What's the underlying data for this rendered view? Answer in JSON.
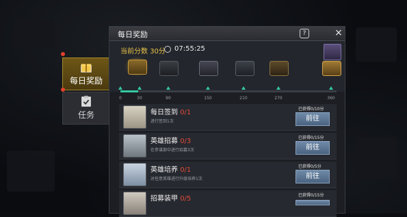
{
  "side_tabs": [
    {
      "label": "每日奖励",
      "icon": "gift-icon",
      "active": true
    },
    {
      "label": "任务",
      "icon": "clipboard-check-icon",
      "active": false
    }
  ],
  "panel": {
    "title": "每日奖励",
    "help_label": "?",
    "close_label": "×"
  },
  "score": {
    "label": "当前分数",
    "value": "30分",
    "timer": "07:55:25"
  },
  "milestones": [
    "0",
    "30",
    "90",
    "150",
    "210",
    "270",
    "360"
  ],
  "progress": 0.083,
  "tasks": [
    {
      "name": "每日签到",
      "progress": "0/1",
      "desc": "进行签到1次",
      "reward": "已获得0/10分",
      "button": "前往",
      "icon": "scroll-icon"
    },
    {
      "name": "英雄招募",
      "progress": "0/3",
      "desc": "在参谋部中进行招募3次",
      "reward": "已获得0/15分",
      "button": "前往",
      "icon": "horn-icon"
    },
    {
      "name": "英雄培养",
      "progress": "0/1",
      "desc": "对任意英雄进行升级培养1次",
      "reward": "已获得0/5分",
      "button": "前往",
      "icon": "document-icon"
    },
    {
      "name": "招募装甲",
      "progress": "0/5",
      "desc": "",
      "reward": "已获得0/15分",
      "button": "前往",
      "icon": "armor-icon"
    }
  ],
  "colors": {
    "accent": "#e9c34a",
    "progress": "#33c9a0",
    "button": "#5a7393",
    "alert": "#e0412b"
  }
}
